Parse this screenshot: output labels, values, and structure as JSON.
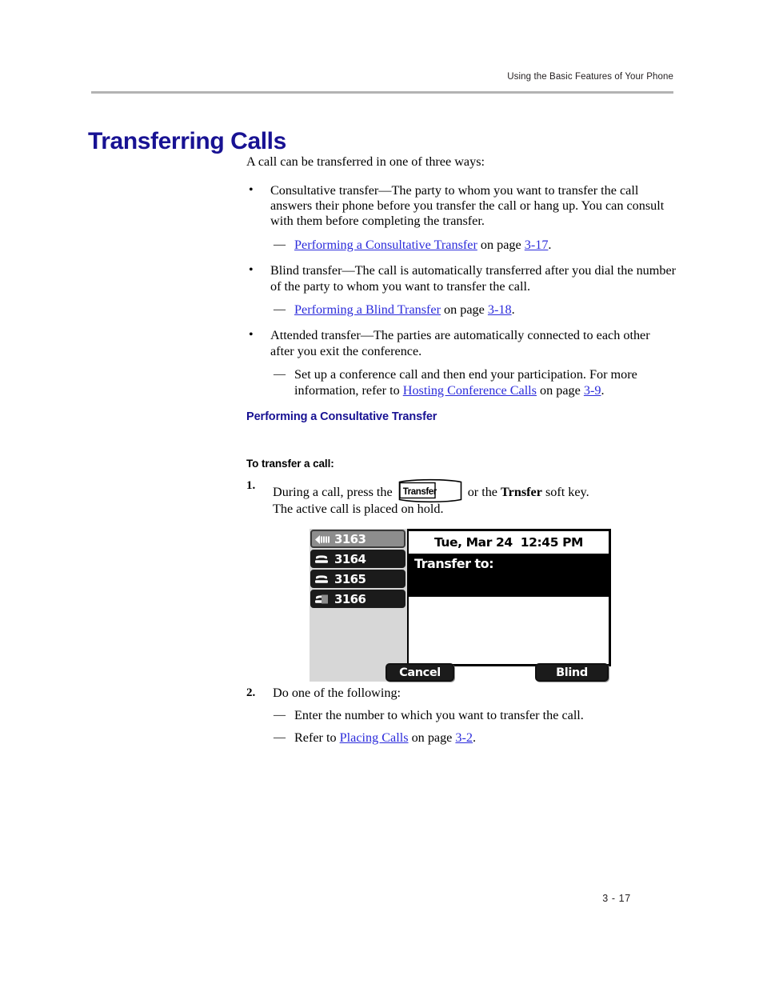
{
  "header": {
    "running_head": "Using the Basic Features of Your Phone"
  },
  "title": "Transferring Calls",
  "intro": "A call can be transferred in one of three ways:",
  "bullets": [
    {
      "text": "Consultative transfer—The party to whom you want to transfer the call answers their phone before you transfer the call or hang up. You can consult with them before completing the transfer.",
      "marker": "•",
      "sub": [
        {
          "marker": "—",
          "link": "Performing a Consultative Transfer",
          "mid": " on page ",
          "page_link": "3-17",
          "tail": "."
        }
      ]
    },
    {
      "text": "Blind transfer—The call is automatically transferred after you dial the number of the party to whom you want to transfer the call.",
      "marker": "•",
      "sub": [
        {
          "marker": "—",
          "link": "Performing a Blind Transfer",
          "mid": " on page ",
          "page_link": "3-18",
          "tail": "."
        }
      ]
    },
    {
      "text": "Attended transfer—The parties are automatically connected to each other after you exit the conference.",
      "marker": "•",
      "sub": [
        {
          "marker": "—",
          "lead": "Set up a conference call and then end your participation. For more information, refer to ",
          "link": "Hosting Conference Calls",
          "mid": " on page ",
          "page_link": "3-9",
          "tail": "."
        }
      ]
    }
  ],
  "section": {
    "heading": "Performing a Consultative Transfer",
    "procedure_heading": "To transfer a call:"
  },
  "steps": [
    {
      "number": "1.",
      "lead": "During a call, press the",
      "key_label": "Transfer",
      "mid": "or the",
      "softkey_name": "Trnsfer",
      "tail": "soft key.",
      "followup": "The active call is placed on hold."
    },
    {
      "number": "2.",
      "lead": "Do one of the following:",
      "sub": [
        {
          "marker": "—",
          "text": "Enter the number to which you want to transfer the call."
        },
        {
          "marker": "—",
          "lead": "Refer to ",
          "link": "Placing Calls",
          "mid": " on page ",
          "page_link": "3-2",
          "tail": "."
        }
      ]
    }
  ],
  "phone_screen": {
    "status_date": "Tue, Mar 24",
    "status_time": "12:45 PM",
    "prompt": "Transfer to:",
    "line_keys": [
      {
        "number": "3163",
        "icon": "active-speaker-icon",
        "state": "active"
      },
      {
        "number": "3164",
        "icon": "handset-icon",
        "state": "idle"
      },
      {
        "number": "3165",
        "icon": "handset-icon",
        "state": "idle"
      },
      {
        "number": "3166",
        "icon": "handset-held-icon",
        "state": "idle"
      }
    ],
    "soft_keys": [
      {
        "label": "Cancel"
      },
      {
        "label": "Blind"
      }
    ]
  },
  "footer": {
    "page_number": "3 - 17"
  },
  "colors": {
    "heading_blue": "#181293",
    "link_blue": "#2b2bdb",
    "rule_gray": "#b3b3b3",
    "screen_gray": "#d7d7d7"
  }
}
